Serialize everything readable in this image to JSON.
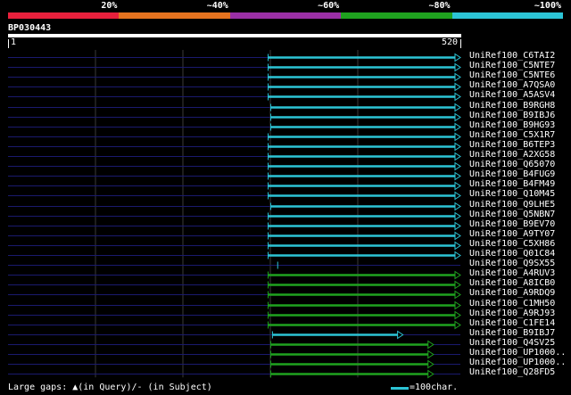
{
  "legend": {
    "segments": [
      {
        "label": "20%",
        "color": "#e8203c"
      },
      {
        "label": "~40%",
        "color": "#e6731f"
      },
      {
        "label": "~60%",
        "color": "#9b2fa6"
      },
      {
        "label": "~80%",
        "color": "#1fa21f"
      },
      {
        "label": "~100%",
        "color": "#2cc4d6"
      }
    ]
  },
  "query": {
    "name": "BP030443",
    "start": "1",
    "end": "520"
  },
  "hits": [
    {
      "label": "UniRef100_C6TAI2",
      "start": 299,
      "end": 520,
      "color": "#2cc4d6"
    },
    {
      "label": "UniRef100_C5NTE7",
      "start": 299,
      "end": 520,
      "color": "#2cc4d6"
    },
    {
      "label": "UniRef100_C5NTE6",
      "start": 299,
      "end": 520,
      "color": "#2cc4d6"
    },
    {
      "label": "UniRef100_A7QSA0",
      "start": 299,
      "end": 520,
      "color": "#2cc4d6"
    },
    {
      "label": "UniRef100_A5ASV4",
      "start": 299,
      "end": 520,
      "color": "#2cc4d6"
    },
    {
      "label": "UniRef100_B9RGH8",
      "start": 302,
      "end": 520,
      "color": "#2cc4d6"
    },
    {
      "label": "UniRef100_B9IBJ6",
      "start": 302,
      "end": 520,
      "color": "#2cc4d6"
    },
    {
      "label": "UniRef100_B9HG93",
      "start": 302,
      "end": 520,
      "color": "#2cc4d6"
    },
    {
      "label": "UniRef100_C5X1R7",
      "start": 299,
      "end": 520,
      "color": "#2cc4d6"
    },
    {
      "label": "UniRef100_B6TEP3",
      "start": 299,
      "end": 520,
      "color": "#2cc4d6"
    },
    {
      "label": "UniRef100_A2XG58",
      "start": 299,
      "end": 520,
      "color": "#2cc4d6"
    },
    {
      "label": "UniRef100_Q65070",
      "start": 299,
      "end": 520,
      "color": "#2cc4d6"
    },
    {
      "label": "UniRef100_B4FUG9",
      "start": 299,
      "end": 520,
      "color": "#2cc4d6"
    },
    {
      "label": "UniRef100_B4FM49",
      "start": 299,
      "end": 520,
      "color": "#2cc4d6"
    },
    {
      "label": "UniRef100_Q10M45",
      "start": 299,
      "end": 520,
      "color": "#2cc4d6"
    },
    {
      "label": "UniRef100_Q9LHE5",
      "start": 302,
      "end": 520,
      "color": "#2cc4d6"
    },
    {
      "label": "UniRef100_Q5NBN7",
      "start": 299,
      "end": 520,
      "color": "#2cc4d6"
    },
    {
      "label": "UniRef100_B9EV70",
      "start": 299,
      "end": 520,
      "color": "#2cc4d6"
    },
    {
      "label": "UniRef100_A9TY07",
      "start": 299,
      "end": 520,
      "color": "#2cc4d6"
    },
    {
      "label": "UniRef100_C5XH86",
      "start": 299,
      "end": 520,
      "color": "#2cc4d6"
    },
    {
      "label": "UniRef100_Q01C84",
      "start": 299,
      "end": 520,
      "color": "#2cc4d6"
    },
    {
      "label": "UniRef100_Q9SX55",
      "start": 310,
      "end": 312,
      "color": "#2cc4d6"
    },
    {
      "label": "UniRef100_A4RUV3",
      "start": 299,
      "end": 520,
      "color": "#1fa21f"
    },
    {
      "label": "UniRef100_A8ICB0",
      "start": 299,
      "end": 520,
      "color": "#1fa21f"
    },
    {
      "label": "UniRef100_A9RDQ9",
      "start": 299,
      "end": 520,
      "color": "#1fa21f"
    },
    {
      "label": "UniRef100_C1MH50",
      "start": 299,
      "end": 520,
      "color": "#1fa21f"
    },
    {
      "label": "UniRef100_A9RJ93",
      "start": 299,
      "end": 520,
      "color": "#1fa21f"
    },
    {
      "label": "UniRef100_C1FE14",
      "start": 299,
      "end": 520,
      "color": "#1fa21f"
    },
    {
      "label": "UniRef100_B9IBJ7",
      "start": 304,
      "end": 454,
      "color": "#2cc4d6"
    },
    {
      "label": "UniRef100_Q4SV25",
      "start": 302,
      "end": 489,
      "color": "#1fa21f"
    },
    {
      "label": "UniRef100_UP1000..",
      "start": 302,
      "end": 489,
      "color": "#1fa21f"
    },
    {
      "label": "UniRef100_UP1000..",
      "start": 302,
      "end": 489,
      "color": "#1fa21f"
    },
    {
      "label": "UniRef100_Q28FD5",
      "start": 302,
      "end": 489,
      "color": "#1fa21f"
    }
  ],
  "footer": {
    "gaps_text": "Large gaps: ▲(in Query)/- (in Subject)",
    "scale_text": "=100char."
  }
}
